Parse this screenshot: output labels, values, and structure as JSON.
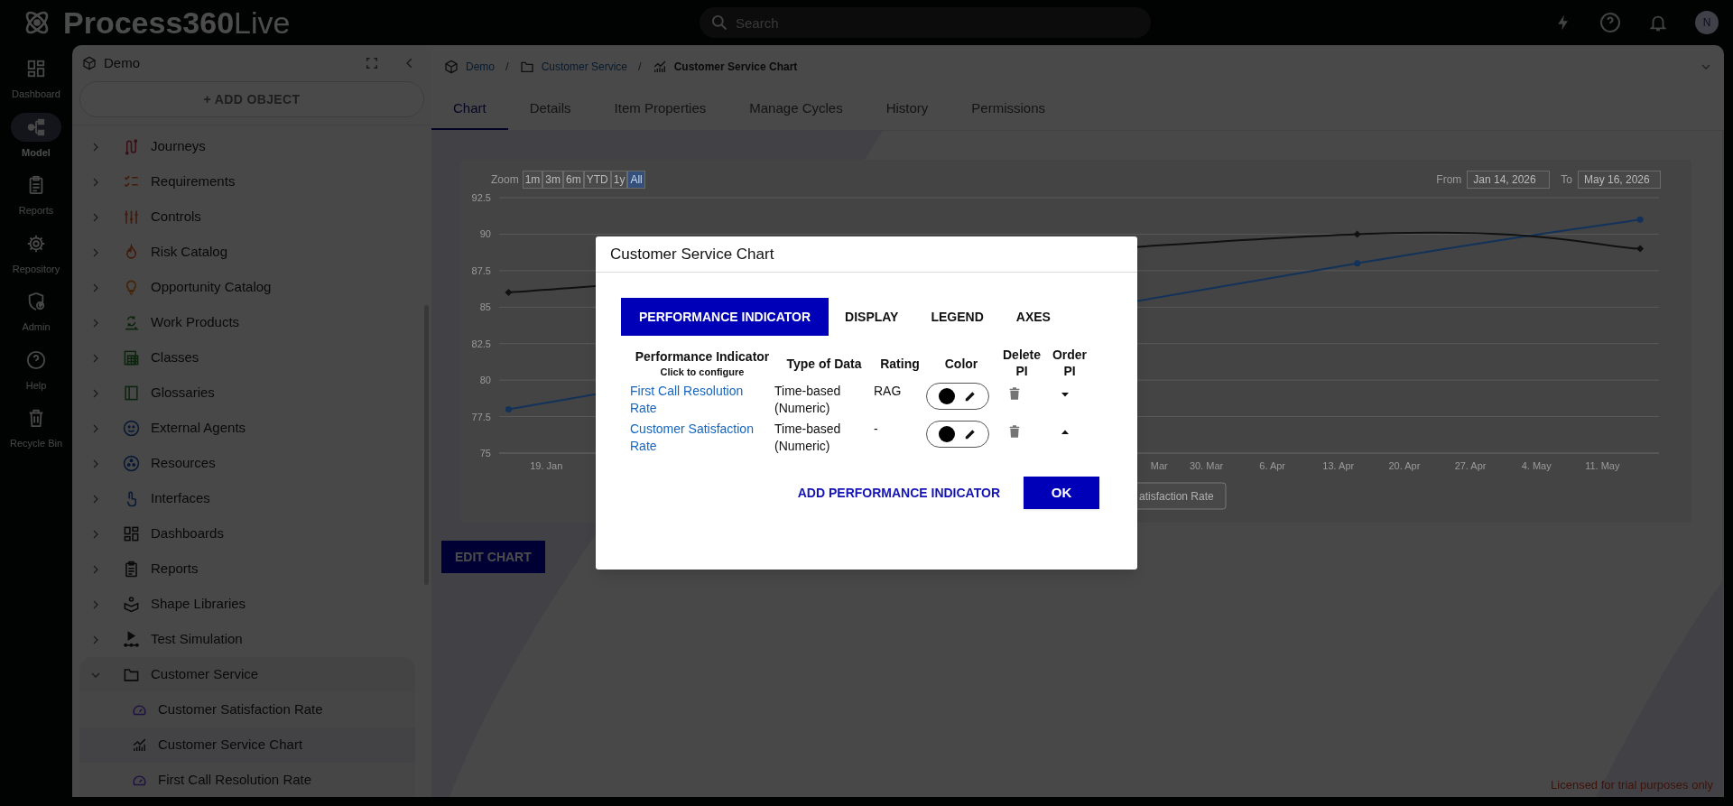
{
  "app": {
    "logo_bold": "Process360",
    "logo_light": "Live",
    "search": {
      "placeholder": "Search"
    },
    "avatar": "N"
  },
  "rail": [
    {
      "label": "Dashboard",
      "kind": "dashboard",
      "selected": false
    },
    {
      "label": "Model",
      "kind": "model",
      "selected": true
    },
    {
      "label": "Reports",
      "kind": "reports",
      "selected": false
    },
    {
      "label": "Repository",
      "kind": "repository",
      "selected": false
    },
    {
      "label": "Admin",
      "kind": "admin",
      "selected": false
    },
    {
      "label": "Help",
      "kind": "help",
      "selected": false
    },
    {
      "label": "Recycle Bin",
      "kind": "recycle_bin",
      "selected": false
    }
  ],
  "tree": {
    "title": "Demo",
    "add_button": "+ ADD OBJECT",
    "items": [
      {
        "label": "Journeys",
        "kind": "journeys",
        "expanded": false
      },
      {
        "label": "Requirements",
        "kind": "requirements",
        "expanded": false
      },
      {
        "label": "Controls",
        "kind": "controls",
        "expanded": false
      },
      {
        "label": "Risk Catalog",
        "kind": "risk",
        "expanded": false
      },
      {
        "label": "Opportunity Catalog",
        "kind": "opportunity",
        "expanded": false
      },
      {
        "label": "Work Products",
        "kind": "work_products",
        "expanded": false
      },
      {
        "label": "Classes",
        "kind": "classes",
        "expanded": false
      },
      {
        "label": "Glossaries",
        "kind": "glossaries",
        "expanded": false
      },
      {
        "label": "External Agents",
        "kind": "external_agents",
        "expanded": false
      },
      {
        "label": "Resources",
        "kind": "resources",
        "expanded": false
      },
      {
        "label": "Interfaces",
        "kind": "interfaces",
        "expanded": false
      },
      {
        "label": "Dashboards",
        "kind": "dashboards",
        "expanded": false
      },
      {
        "label": "Reports",
        "kind": "reports",
        "expanded": false
      },
      {
        "label": "Shape Libraries",
        "kind": "shape_libraries",
        "expanded": false
      },
      {
        "label": "Test Simulation",
        "kind": "test_simulation",
        "expanded": false
      },
      {
        "label": "Customer Service",
        "kind": "folder",
        "expanded": true,
        "children": [
          {
            "label": "Customer Satisfaction Rate",
            "kind": "gauge",
            "selected": false
          },
          {
            "label": "Customer Service Chart",
            "kind": "chart",
            "selected": true
          },
          {
            "label": "First Call Resolution Rate",
            "kind": "gauge",
            "selected": false
          }
        ]
      }
    ]
  },
  "breadcrumb": [
    {
      "label": "Demo",
      "kind": "cube"
    },
    {
      "separator": "/",
      "label": "Customer Service",
      "kind": "folder"
    },
    {
      "separator": "/",
      "label": "Customer Service Chart",
      "kind": "chart"
    }
  ],
  "tabs": [
    {
      "label": "Chart",
      "selected": true
    },
    {
      "label": "Details",
      "selected": false
    },
    {
      "label": "Item Properties",
      "selected": false
    },
    {
      "label": "Manage Cycles",
      "selected": false
    },
    {
      "label": "History",
      "selected": false
    },
    {
      "label": "Permissions",
      "selected": false
    }
  ],
  "chart": {
    "zoom_label": "Zoom",
    "zoom_buttons": [
      {
        "label": "1m",
        "selected": false
      },
      {
        "label": "3m",
        "selected": false
      },
      {
        "label": "6m",
        "selected": false
      },
      {
        "label": "YTD",
        "selected": false
      },
      {
        "label": "1y",
        "selected": false
      },
      {
        "label": "All",
        "selected": true
      }
    ],
    "from_label": "From",
    "from": "Jan 14, 2026",
    "to_label": "To",
    "to": "May 16, 2026",
    "legend_items": [
      "atisfaction Rate"
    ],
    "chart_data": {
      "type": "line",
      "grid": true,
      "x": [
        "2026-01-15",
        "2026-04-15",
        "2026-05-15"
      ],
      "xlim": [
        "2026-01-14",
        "2026-05-17"
      ],
      "ylim": [
        75,
        92.5
      ],
      "yticks": [
        75,
        77.5,
        80,
        82.5,
        85,
        87.5,
        90,
        92.5
      ],
      "xticks": [
        {
          "value": "2026-01-19",
          "label": "19. Jan"
        },
        {
          "value": "2026-03-25",
          "label": "Mar"
        },
        {
          "value": "2026-03-30",
          "label": "30. Mar"
        },
        {
          "value": "2026-04-06",
          "label": "6. Apr"
        },
        {
          "value": "2026-04-13",
          "label": "13. Apr"
        },
        {
          "value": "2026-04-20",
          "label": "20. Apr"
        },
        {
          "value": "2026-04-27",
          "label": "27. Apr"
        },
        {
          "value": "2026-05-04",
          "label": "4. May"
        },
        {
          "value": "2026-05-11",
          "label": "11. May"
        }
      ],
      "series": [
        {
          "color": "#12325a",
          "marker": "circle",
          "values": [
            78,
            88,
            91
          ]
        },
        {
          "color": "#111111",
          "marker": "diamond",
          "values": [
            86,
            90,
            89
          ]
        }
      ]
    }
  },
  "edit_chart_button": "EDIT CHART",
  "license_note": "Licensed for trial purposes only",
  "dialog": {
    "title": "Customer Service Chart",
    "tabs": [
      {
        "label": "PERFORMANCE INDICATOR",
        "selected": true
      },
      {
        "label": "DISPLAY",
        "selected": false
      },
      {
        "label": "LEGEND",
        "selected": false
      },
      {
        "label": "AXES",
        "selected": false
      }
    ],
    "columns": [
      "Performance Indicator",
      "Type of Data",
      "Rating",
      "Color",
      "Delete PI",
      "Order PI"
    ],
    "column_hint": "Click to configure",
    "rows": [
      {
        "name": "First Call Resolution Rate",
        "type": "Time-based (Numeric)",
        "rating": "RAG",
        "color": "#000000",
        "kind": "move_down"
      },
      {
        "name": "Customer Satisfaction Rate",
        "type": "Time-based (Numeric)",
        "rating": "-",
        "color": "#000000",
        "kind": "move_up"
      }
    ],
    "add_button": "ADD PERFORMANCE INDICATOR",
    "ok_button": "OK"
  }
}
